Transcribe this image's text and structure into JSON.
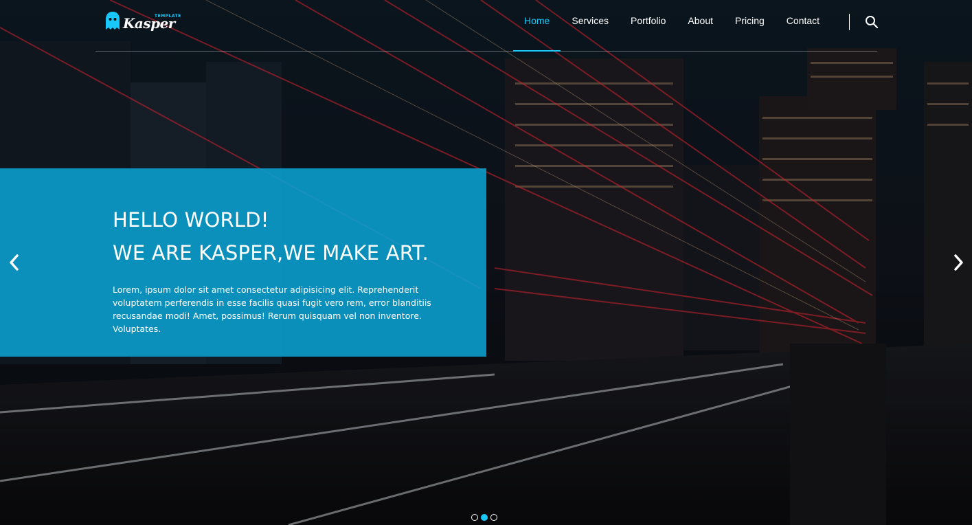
{
  "brand": {
    "logo_small_text": "TEMPLATE",
    "logo_text": "Kasper",
    "accent_color": "#19c8fa"
  },
  "nav": {
    "items": [
      {
        "label": "Home",
        "active": true
      },
      {
        "label": "Services",
        "active": false
      },
      {
        "label": "Portfolio",
        "active": false
      },
      {
        "label": "About",
        "active": false
      },
      {
        "label": "Pricing",
        "active": false
      },
      {
        "label": "Contact",
        "active": false
      }
    ],
    "search_icon": "search-icon"
  },
  "slide": {
    "title_line1": "HELLO WORLD!",
    "title_line2": "WE ARE KASPER,WE MAKE ART.",
    "text": "Lorem, ipsum dolor sit amet consectetur adipisicing elit. Reprehenderit voluptatem perferendis in esse facilis quasi fugit vero rem, error blanditiis recusandae modi! Amet, possimus! Rerum quisquam vel non inventore. Voluptates.",
    "box_color": "#0aa0d2"
  },
  "controls": {
    "prev_icon": "chevron-left-icon",
    "next_icon": "chevron-right-icon",
    "bullets": [
      {
        "active": false
      },
      {
        "active": true
      },
      {
        "active": false
      }
    ]
  }
}
